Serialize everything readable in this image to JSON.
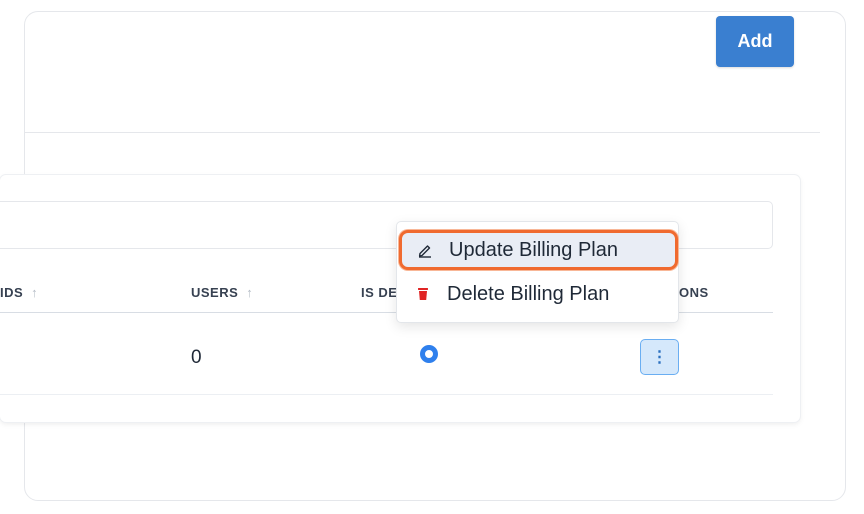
{
  "toolbar": {
    "add_label": "Add"
  },
  "table": {
    "columns": [
      {
        "label": "IDS",
        "sortable": true
      },
      {
        "label": "USERS",
        "sortable": true
      },
      {
        "label": "IS DE",
        "sortable": false
      },
      {
        "label": "ONS",
        "sortable": false
      }
    ],
    "sort_indicator": "↑",
    "rows": [
      {
        "users": "0",
        "is_default": true
      }
    ],
    "actions_glyph": "⋮"
  },
  "menu": {
    "items": [
      {
        "label": "Update Billing Plan",
        "icon": "edit-icon",
        "highlighted": true
      },
      {
        "label": "Delete Billing Plan",
        "icon": "trash-icon",
        "highlighted": false
      }
    ]
  },
  "colors": {
    "primary": "#3a7fd0",
    "highlight_outline": "#f06a2f",
    "delete_icon": "#e02424",
    "radio": "#2f80ed"
  }
}
